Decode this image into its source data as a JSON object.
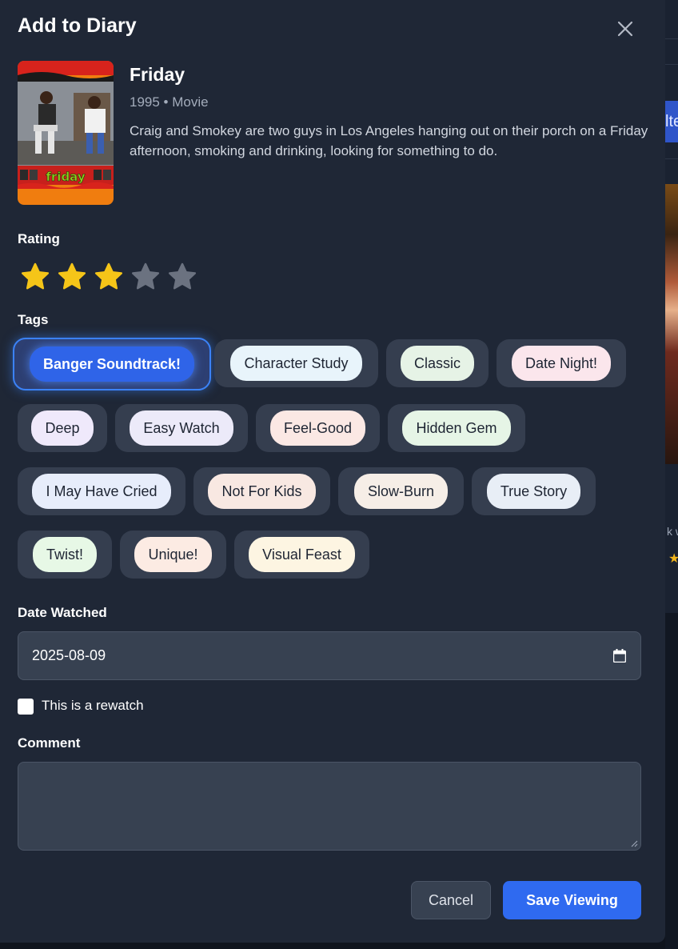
{
  "modal": {
    "title": "Add to Diary",
    "close_icon": "close-icon"
  },
  "movie": {
    "title": "Friday",
    "meta": "1995 • Movie",
    "description": "Craig and Smokey are two guys in Los Angeles hanging out on their porch on a Friday afternoon, smoking and drinking, looking for something to do.",
    "poster_text": "friday"
  },
  "rating": {
    "label": "Rating",
    "value": 3,
    "max": 5,
    "filled_color": "#f5c518",
    "empty_color": "#6b7280"
  },
  "tags": {
    "label": "Tags",
    "items": [
      {
        "label": "Banger Soundtrack!",
        "color": "#2f64e8",
        "selected": true
      },
      {
        "label": "Character Study",
        "color": "#e8f4fb",
        "selected": false
      },
      {
        "label": "Classic",
        "color": "#e6f3e6",
        "selected": false
      },
      {
        "label": "Date Night!",
        "color": "#fbe6ec",
        "selected": false
      },
      {
        "label": "Deep",
        "color": "#efe9fb",
        "selected": false
      },
      {
        "label": "Easy Watch",
        "color": "#eceaf9",
        "selected": false
      },
      {
        "label": "Feel-Good",
        "color": "#fbe8e4",
        "selected": false
      },
      {
        "label": "Hidden Gem",
        "color": "#e6f5e6",
        "selected": false
      },
      {
        "label": "I May Have Cried",
        "color": "#e7edfb",
        "selected": false
      },
      {
        "label": "Not For Kids",
        "color": "#f8e8e2",
        "selected": false
      },
      {
        "label": "Slow-Burn",
        "color": "#f6eee7",
        "selected": false
      },
      {
        "label": "True Story",
        "color": "#e8eef6",
        "selected": false
      },
      {
        "label": "Twist!",
        "color": "#e7f8e6",
        "selected": false
      },
      {
        "label": "Unique!",
        "color": "#fcebe3",
        "selected": false
      },
      {
        "label": "Visual Feast",
        "color": "#fdf5e2",
        "selected": false
      }
    ]
  },
  "date_watched": {
    "label": "Date Watched",
    "value": "2025-08-09",
    "icon": "calendar-icon"
  },
  "rewatch": {
    "label": "This is a rewatch",
    "checked": false
  },
  "comment": {
    "label": "Comment",
    "value": ""
  },
  "actions": {
    "cancel_label": "Cancel",
    "save_label": "Save Viewing"
  },
  "background": {
    "button_text": "lte",
    "snippet_text": "k w"
  }
}
